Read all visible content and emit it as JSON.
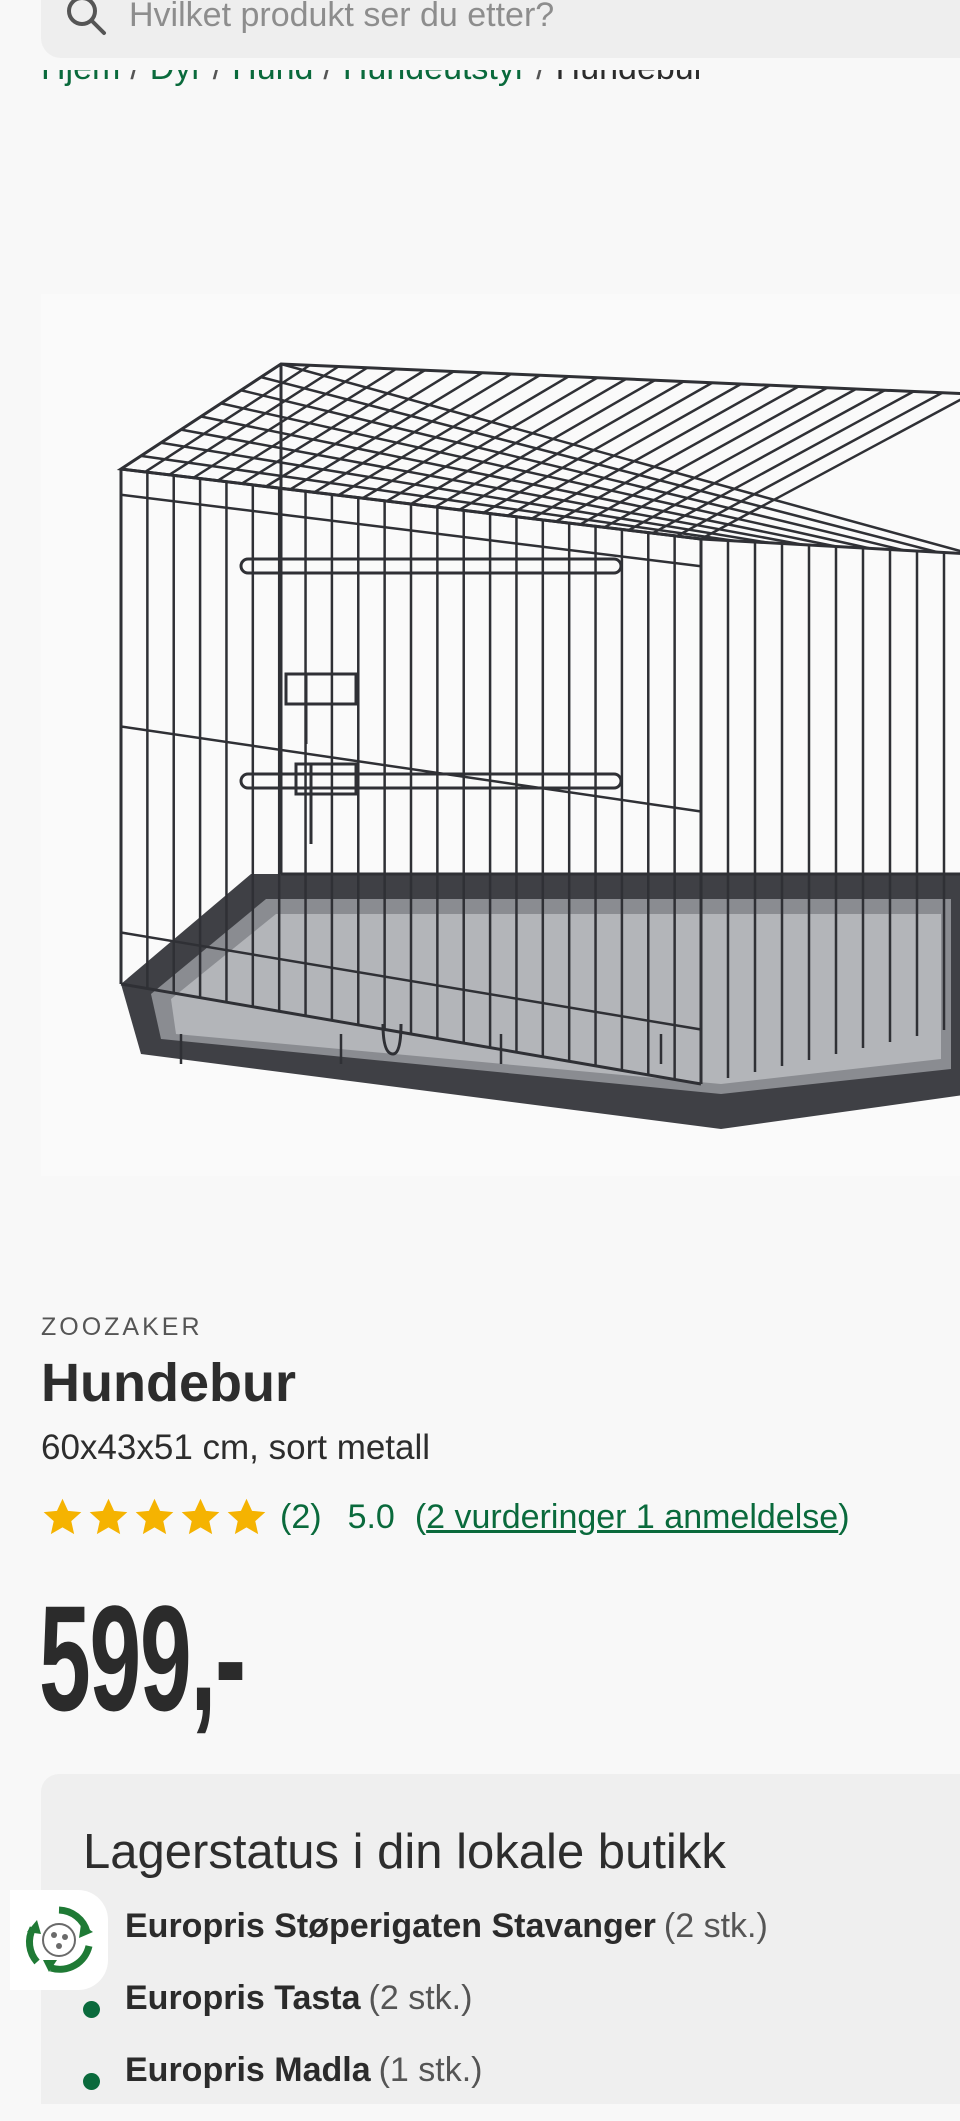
{
  "search": {
    "placeholder": "Hvilket produkt ser du etter?"
  },
  "breadcrumb": [
    {
      "label": "Hjem"
    },
    {
      "label": "Dyr"
    },
    {
      "label": "Hund"
    },
    {
      "label": "Hundeutstyr"
    },
    {
      "label": "Hundebur"
    }
  ],
  "product": {
    "brand": "ZOOZAKER",
    "title": "Hundebur",
    "subtitle": "60x43x51 cm, sort metall",
    "rating": {
      "stars": 5,
      "count_label": "(2)",
      "value": "5.0",
      "reviews_open": "(",
      "reviews_link": "2 vurderinger 1 anmeldelse",
      "reviews_close": ")"
    },
    "price": "599,-"
  },
  "stock": {
    "title": "Lagerstatus i din lokale butikk",
    "stores": [
      {
        "name": "Europris Støperigaten Stavanger",
        "qty": "(2 stk.)"
      },
      {
        "name": "Europris Tasta",
        "qty": "(2 stk.)"
      },
      {
        "name": "Europris Madla",
        "qty": "(1 stk.)"
      }
    ]
  },
  "colors": {
    "accent": "#0a6a3c",
    "star": "#f5b301",
    "text": "#2b2b2b"
  },
  "icons": {
    "search": "search-icon",
    "star": "star-icon",
    "recycle": "recycle-icon"
  }
}
